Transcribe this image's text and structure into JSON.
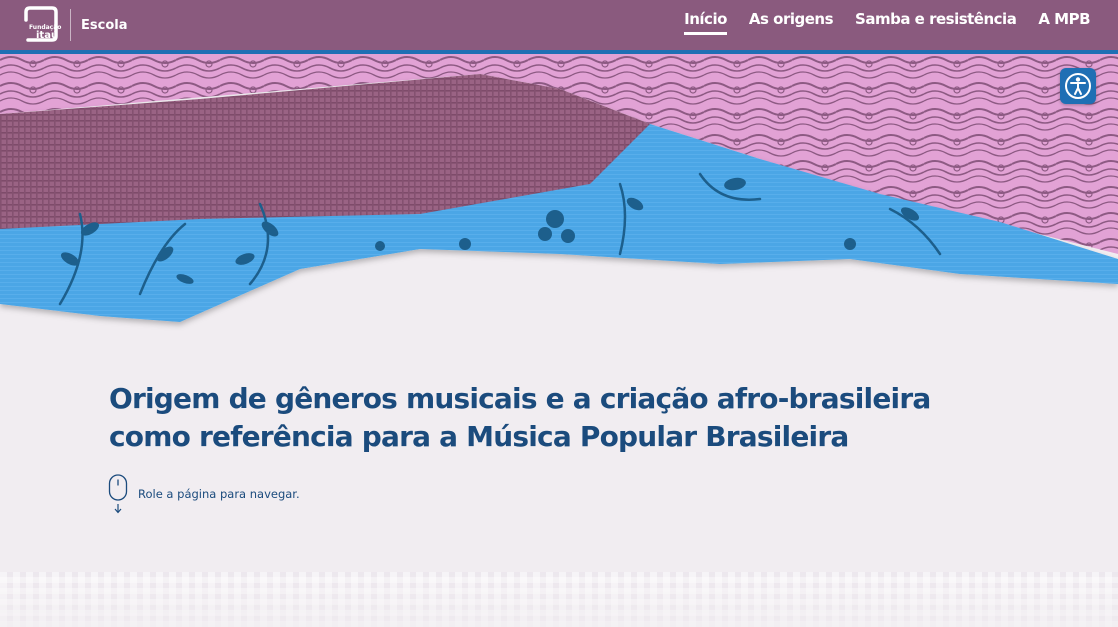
{
  "header": {
    "logo": {
      "line1": "Fundação",
      "line2": "itaú",
      "icon": "fundacao-itau-logo"
    },
    "brand": "Escola",
    "nav": [
      {
        "label": "Início",
        "active": true
      },
      {
        "label": "As origens",
        "active": false
      },
      {
        "label": "Samba e resistência",
        "active": false
      },
      {
        "label": "A MPB",
        "active": false
      }
    ]
  },
  "accessibility": {
    "icon": "accessibility-person-icon"
  },
  "main": {
    "title_line1": "Origem de gêneros musicais e a criação afro-brasileira",
    "title_line2": "como referência para a Música Popular Brasileira",
    "scroll_hint": "Role a página para navegar.",
    "scroll_icon": "mouse-scroll-icon"
  },
  "colors": {
    "header_bg": "#8a5a7e",
    "header_accent": "#1f6fb4",
    "title": "#1b4b7d",
    "page_bg": "#f1edf1",
    "fabric_pink": "#e6a6d8",
    "fabric_mauve": "#986583",
    "fabric_blue": "#4aa5e6"
  }
}
